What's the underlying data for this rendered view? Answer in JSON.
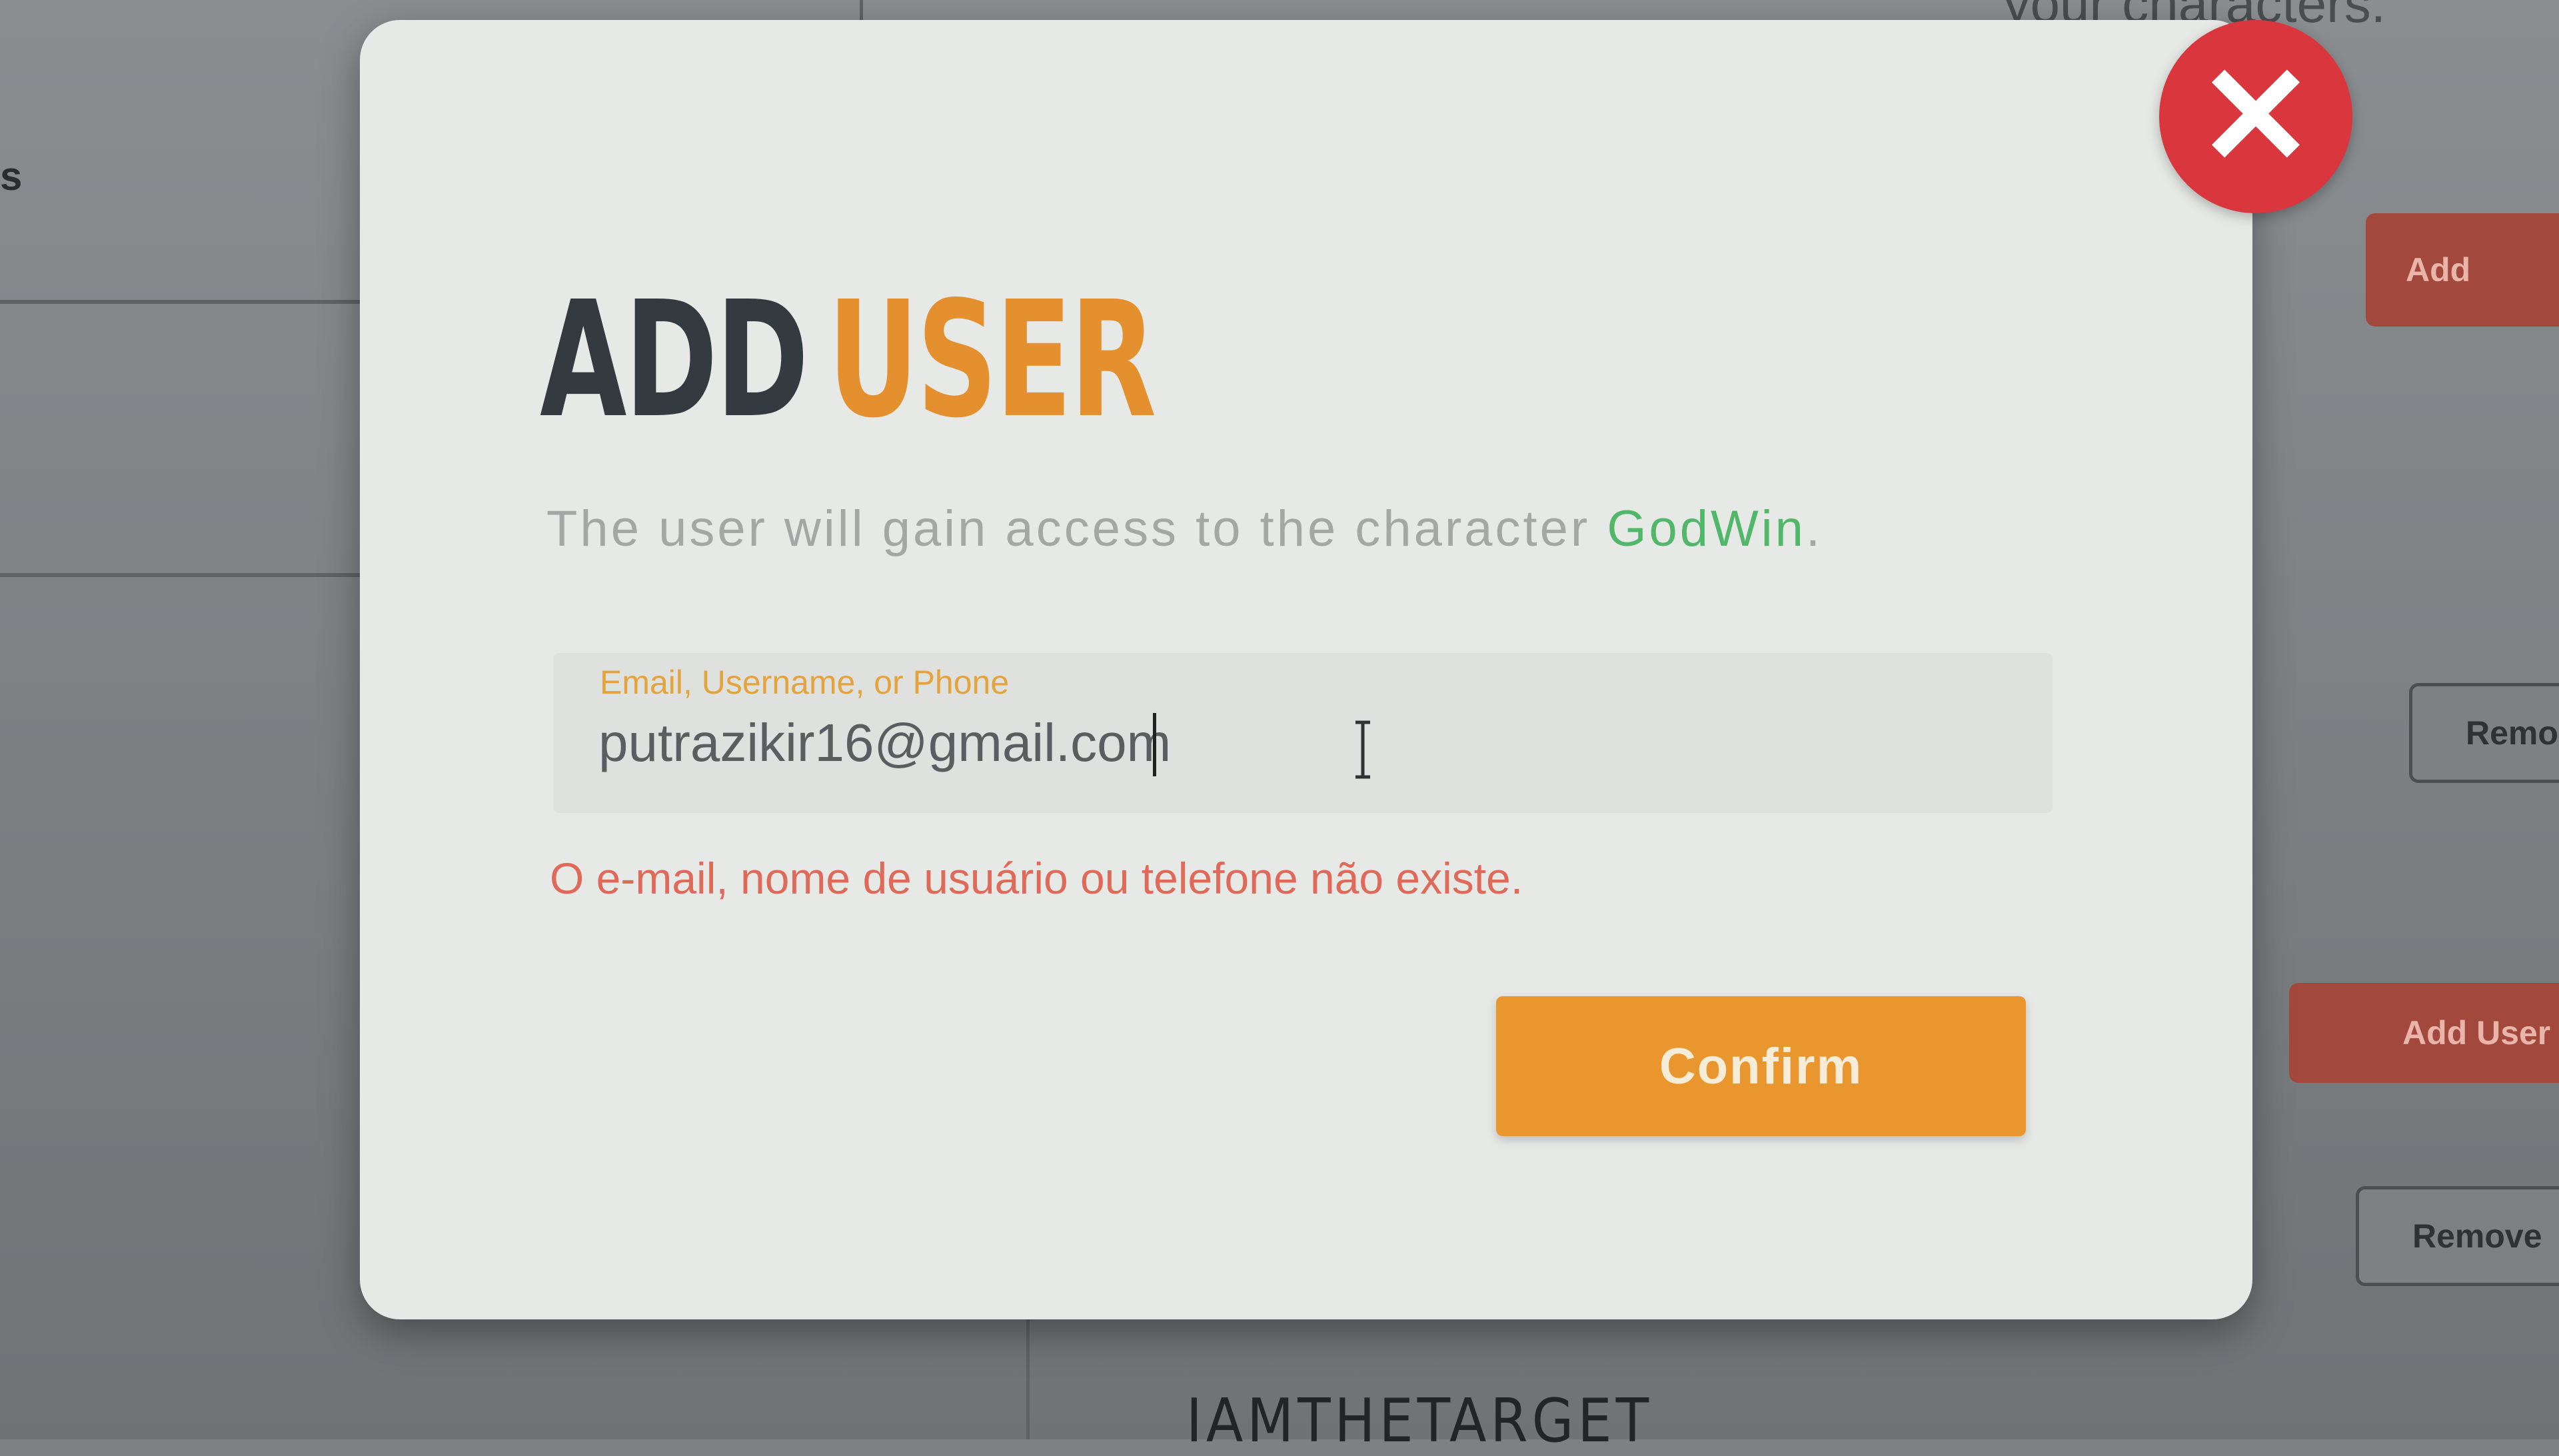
{
  "background": {
    "side_letter": "s",
    "top_text": "your characters.",
    "buttons": {
      "add_top": "Add",
      "remove_1": "Remo",
      "add_user": "Add User",
      "remove_2": "Remove"
    },
    "bottom_name": "IAMTHETARGET"
  },
  "modal": {
    "close_icon": "close-icon",
    "title_part1": "ADD",
    "title_part2": "USER",
    "subtitle_prefix": "The user will gain access to the character",
    "character_name": "GodWin",
    "subtitle_suffix": ".",
    "field_label": "Email, Username, or Phone",
    "field_value": "putrazikir16@gmail.com",
    "error_message": "O e-mail, nome de usuário ou telefone não existe.",
    "confirm_label": "Confirm"
  },
  "colors": {
    "accent_orange": "#e5902f",
    "close_red": "#d9373d",
    "character_green": "#51b86a",
    "error_red": "#e06a5a"
  }
}
